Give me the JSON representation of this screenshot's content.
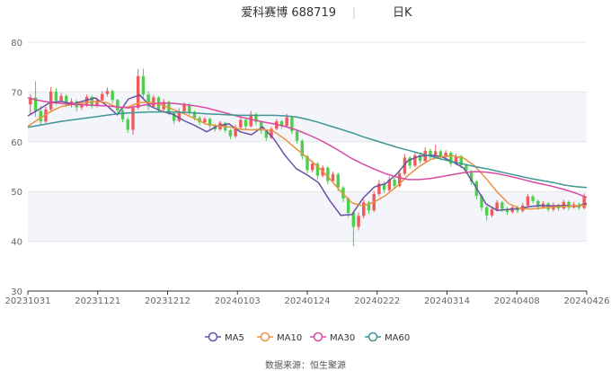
{
  "chart_data": {
    "type": "candlestick",
    "title": "爱科赛博 688719",
    "period_label": "日K",
    "ylim": [
      30,
      80
    ],
    "y_ticks": [
      "80",
      "70",
      "60",
      "50",
      "40",
      "30"
    ],
    "x_ticks": [
      "20231031",
      "20231121",
      "20231212",
      "20240103",
      "20240124",
      "20240222",
      "20240314",
      "20240408",
      "20240426"
    ],
    "legend": [
      {
        "name": "MA5",
        "color": "#6a4fa5"
      },
      {
        "name": "MA10",
        "color": "#e8913e"
      },
      {
        "name": "MA30",
        "color": "#d84aa2"
      },
      {
        "name": "MA60",
        "color": "#3e9695"
      }
    ],
    "up_color": "#f05a5a",
    "down_color": "#4cd04c",
    "grid": true,
    "candles": [
      {
        "o": 67.5,
        "c": 68.9,
        "h": 69.5,
        "l": 65.5
      },
      {
        "o": 68.9,
        "c": 66.2,
        "h": 72.2,
        "l": 65.0
      },
      {
        "o": 66.2,
        "c": 64.1,
        "h": 67.2,
        "l": 63.3
      },
      {
        "o": 64.1,
        "c": 66.5,
        "h": 67.0,
        "l": 63.8
      },
      {
        "o": 66.5,
        "c": 70.1,
        "h": 71.0,
        "l": 66.0
      },
      {
        "o": 70.1,
        "c": 68.3,
        "h": 70.8,
        "l": 67.4
      },
      {
        "o": 68.3,
        "c": 69.2,
        "h": 69.8,
        "l": 67.9
      },
      {
        "o": 69.2,
        "c": 67.6,
        "h": 69.6,
        "l": 67.0
      },
      {
        "o": 67.6,
        "c": 68.1,
        "h": 68.7,
        "l": 66.9
      },
      {
        "o": 68.1,
        "c": 66.9,
        "h": 68.4,
        "l": 66.2
      },
      {
        "o": 66.9,
        "c": 67.3,
        "h": 67.9,
        "l": 66.4
      },
      {
        "o": 67.3,
        "c": 69.0,
        "h": 69.5,
        "l": 67.0
      },
      {
        "o": 69.0,
        "c": 67.2,
        "h": 69.3,
        "l": 66.6
      },
      {
        "o": 67.2,
        "c": 68.3,
        "h": 68.9,
        "l": 66.9
      },
      {
        "o": 68.3,
        "c": 69.6,
        "h": 70.2,
        "l": 68.0
      },
      {
        "o": 69.6,
        "c": 70.2,
        "h": 70.9,
        "l": 69.1
      },
      {
        "o": 70.2,
        "c": 68.4,
        "h": 70.5,
        "l": 67.7
      },
      {
        "o": 68.4,
        "c": 66.3,
        "h": 68.6,
        "l": 65.8
      },
      {
        "o": 66.3,
        "c": 64.5,
        "h": 66.7,
        "l": 63.9
      },
      {
        "o": 64.5,
        "c": 62.4,
        "h": 65.0,
        "l": 61.8
      },
      {
        "o": 62.4,
        "c": 66.8,
        "h": 67.5,
        "l": 61.4
      },
      {
        "o": 66.8,
        "c": 73.2,
        "h": 74.6,
        "l": 66.5
      },
      {
        "o": 73.2,
        "c": 69.5,
        "h": 74.7,
        "l": 68.5
      },
      {
        "o": 69.5,
        "c": 67.1,
        "h": 70.2,
        "l": 66.3
      },
      {
        "o": 67.1,
        "c": 68.9,
        "h": 69.4,
        "l": 66.8
      },
      {
        "o": 68.9,
        "c": 66.5,
        "h": 69.2,
        "l": 66.0
      },
      {
        "o": 66.5,
        "c": 68.0,
        "h": 68.6,
        "l": 66.1
      },
      {
        "o": 68.0,
        "c": 65.8,
        "h": 68.3,
        "l": 65.3
      },
      {
        "o": 65.8,
        "c": 64.2,
        "h": 66.1,
        "l": 63.6
      },
      {
        "o": 64.2,
        "c": 66.1,
        "h": 66.7,
        "l": 63.9
      },
      {
        "o": 66.1,
        "c": 67.4,
        "h": 67.9,
        "l": 65.8
      },
      {
        "o": 67.4,
        "c": 66.0,
        "h": 67.8,
        "l": 65.4
      },
      {
        "o": 66.0,
        "c": 64.8,
        "h": 66.3,
        "l": 64.3
      },
      {
        "o": 64.8,
        "c": 63.9,
        "h": 65.2,
        "l": 63.4
      },
      {
        "o": 63.9,
        "c": 64.6,
        "h": 65.0,
        "l": 63.6
      },
      {
        "o": 64.6,
        "c": 63.2,
        "h": 64.9,
        "l": 62.7
      },
      {
        "o": 63.2,
        "c": 62.5,
        "h": 63.6,
        "l": 62.0
      },
      {
        "o": 62.5,
        "c": 63.8,
        "h": 64.2,
        "l": 62.2
      },
      {
        "o": 63.8,
        "c": 62.3,
        "h": 64.0,
        "l": 61.9
      },
      {
        "o": 62.3,
        "c": 61.1,
        "h": 62.6,
        "l": 60.5
      },
      {
        "o": 61.1,
        "c": 62.9,
        "h": 63.4,
        "l": 60.8
      },
      {
        "o": 62.9,
        "c": 64.4,
        "h": 64.9,
        "l": 62.6
      },
      {
        "o": 64.4,
        "c": 63.1,
        "h": 64.7,
        "l": 62.6
      },
      {
        "o": 63.1,
        "c": 65.5,
        "h": 66.2,
        "l": 62.9
      },
      {
        "o": 65.5,
        "c": 64.0,
        "h": 65.9,
        "l": 63.4
      },
      {
        "o": 64.0,
        "c": 62.2,
        "h": 64.3,
        "l": 61.6
      },
      {
        "o": 62.2,
        "c": 60.8,
        "h": 62.5,
        "l": 60.2
      },
      {
        "o": 60.8,
        "c": 62.6,
        "h": 63.0,
        "l": 60.5
      },
      {
        "o": 62.6,
        "c": 64.1,
        "h": 64.6,
        "l": 62.3
      },
      {
        "o": 64.1,
        "c": 63.2,
        "h": 64.4,
        "l": 62.7
      },
      {
        "o": 63.2,
        "c": 64.9,
        "h": 65.6,
        "l": 62.9
      },
      {
        "o": 64.9,
        "c": 62.1,
        "h": 65.2,
        "l": 61.5
      },
      {
        "o": 62.1,
        "c": 60.2,
        "h": 62.4,
        "l": 59.6
      },
      {
        "o": 60.2,
        "c": 57.1,
        "h": 60.5,
        "l": 56.4
      },
      {
        "o": 57.1,
        "c": 54.3,
        "h": 57.4,
        "l": 53.6
      },
      {
        "o": 54.3,
        "c": 55.6,
        "h": 56.2,
        "l": 53.8
      },
      {
        "o": 55.6,
        "c": 53.2,
        "h": 55.9,
        "l": 52.5
      },
      {
        "o": 53.2,
        "c": 54.8,
        "h": 55.3,
        "l": 52.8
      },
      {
        "o": 54.8,
        "c": 52.1,
        "h": 55.1,
        "l": 51.4
      },
      {
        "o": 52.1,
        "c": 53.5,
        "h": 54.0,
        "l": 51.7
      },
      {
        "o": 53.5,
        "c": 50.8,
        "h": 53.8,
        "l": 50.1
      },
      {
        "o": 50.8,
        "c": 48.6,
        "h": 51.1,
        "l": 47.9
      },
      {
        "o": 48.6,
        "c": 45.7,
        "h": 48.9,
        "l": 44.8
      },
      {
        "o": 45.7,
        "c": 42.9,
        "h": 46.0,
        "l": 39.0
      },
      {
        "o": 42.9,
        "c": 45.1,
        "h": 45.8,
        "l": 42.2
      },
      {
        "o": 45.1,
        "c": 47.8,
        "h": 48.4,
        "l": 44.6
      },
      {
        "o": 47.8,
        "c": 46.2,
        "h": 48.1,
        "l": 45.5
      },
      {
        "o": 46.2,
        "c": 49.5,
        "h": 50.1,
        "l": 45.9
      },
      {
        "o": 49.5,
        "c": 51.6,
        "h": 52.3,
        "l": 49.1
      },
      {
        "o": 51.6,
        "c": 50.3,
        "h": 52.0,
        "l": 49.7
      },
      {
        "o": 50.3,
        "c": 52.4,
        "h": 53.0,
        "l": 50.0
      },
      {
        "o": 52.4,
        "c": 51.1,
        "h": 52.8,
        "l": 50.5
      },
      {
        "o": 51.1,
        "c": 53.6,
        "h": 54.2,
        "l": 50.8
      },
      {
        "o": 53.6,
        "c": 56.8,
        "h": 57.5,
        "l": 53.2
      },
      {
        "o": 56.8,
        "c": 55.2,
        "h": 57.1,
        "l": 54.6
      },
      {
        "o": 55.2,
        "c": 57.3,
        "h": 58.0,
        "l": 54.9
      },
      {
        "o": 57.3,
        "c": 56.1,
        "h": 57.7,
        "l": 55.6
      },
      {
        "o": 56.1,
        "c": 58.2,
        "h": 58.9,
        "l": 55.8
      },
      {
        "o": 58.2,
        "c": 57.0,
        "h": 58.6,
        "l": 56.4
      },
      {
        "o": 57.0,
        "c": 58.1,
        "h": 59.4,
        "l": 56.7
      },
      {
        "o": 58.1,
        "c": 56.9,
        "h": 58.4,
        "l": 56.3
      },
      {
        "o": 56.9,
        "c": 57.8,
        "h": 58.3,
        "l": 56.5
      },
      {
        "o": 57.8,
        "c": 55.6,
        "h": 58.1,
        "l": 55.0
      },
      {
        "o": 55.6,
        "c": 57.1,
        "h": 57.6,
        "l": 55.3
      },
      {
        "o": 57.1,
        "c": 55.3,
        "h": 57.4,
        "l": 54.7
      },
      {
        "o": 55.3,
        "c": 54.1,
        "h": 55.6,
        "l": 53.5
      },
      {
        "o": 54.1,
        "c": 52.0,
        "h": 54.4,
        "l": 51.3
      },
      {
        "o": 52.0,
        "c": 49.1,
        "h": 52.3,
        "l": 48.4
      },
      {
        "o": 49.1,
        "c": 46.8,
        "h": 49.4,
        "l": 46.1
      },
      {
        "o": 46.8,
        "c": 45.2,
        "h": 47.1,
        "l": 44.1
      },
      {
        "o": 45.2,
        "c": 46.4,
        "h": 46.9,
        "l": 44.8
      },
      {
        "o": 46.4,
        "c": 47.8,
        "h": 48.3,
        "l": 46.0
      },
      {
        "o": 47.8,
        "c": 46.5,
        "h": 48.1,
        "l": 45.9
      },
      {
        "o": 46.5,
        "c": 45.9,
        "h": 46.9,
        "l": 45.3
      },
      {
        "o": 45.9,
        "c": 46.8,
        "h": 47.3,
        "l": 45.5
      },
      {
        "o": 46.8,
        "c": 46.1,
        "h": 47.2,
        "l": 45.6
      },
      {
        "o": 46.1,
        "c": 47.2,
        "h": 47.7,
        "l": 45.8
      },
      {
        "o": 47.2,
        "c": 49.0,
        "h": 49.5,
        "l": 46.9
      },
      {
        "o": 49.0,
        "c": 48.1,
        "h": 49.4,
        "l": 47.6
      },
      {
        "o": 48.1,
        "c": 46.9,
        "h": 48.4,
        "l": 46.3
      },
      {
        "o": 46.9,
        "c": 47.6,
        "h": 48.1,
        "l": 46.5
      },
      {
        "o": 47.6,
        "c": 46.4,
        "h": 47.9,
        "l": 45.9
      },
      {
        "o": 46.4,
        "c": 47.3,
        "h": 47.8,
        "l": 46.0
      },
      {
        "o": 47.3,
        "c": 46.6,
        "h": 47.6,
        "l": 46.1
      },
      {
        "o": 46.6,
        "c": 47.9,
        "h": 48.3,
        "l": 46.3
      },
      {
        "o": 47.9,
        "c": 46.8,
        "h": 48.2,
        "l": 46.2
      },
      {
        "o": 46.8,
        "c": 47.4,
        "h": 47.9,
        "l": 46.5
      },
      {
        "o": 47.4,
        "c": 46.7,
        "h": 47.8,
        "l": 46.3
      },
      {
        "o": 46.7,
        "c": 49.1,
        "h": 49.6,
        "l": 46.4
      }
    ],
    "series": [
      {
        "name": "MA5",
        "x_frac": [
          0,
          0.02,
          0.04,
          0.06,
          0.08,
          0.1,
          0.12,
          0.14,
          0.16,
          0.18,
          0.2,
          0.22,
          0.24,
          0.26,
          0.28,
          0.3,
          0.32,
          0.34,
          0.36,
          0.38,
          0.4,
          0.42,
          0.44,
          0.46,
          0.48,
          0.5,
          0.52,
          0.54,
          0.56,
          0.58,
          0.6,
          0.62,
          0.64,
          0.66,
          0.68,
          0.7,
          0.72,
          0.74,
          0.76,
          0.78,
          0.8,
          0.82,
          0.84,
          0.86,
          0.88,
          0.9,
          0.92,
          0.94,
          0.96,
          0.98,
          1.0
        ],
        "values": [
          65.2,
          66.5,
          67.9,
          68.1,
          67.6,
          68.2,
          68.8,
          67.4,
          65.4,
          68.6,
          69.4,
          67.1,
          66.1,
          65.5,
          64.2,
          63.2,
          62.0,
          63.2,
          63.6,
          62.0,
          61.4,
          63.0,
          60.6,
          57.3,
          54.6,
          53.3,
          51.8,
          48.2,
          45.2,
          45.4,
          48.7,
          50.9,
          51.6,
          53.5,
          56.2,
          57.1,
          57.3,
          57.0,
          56.0,
          54.7,
          51.2,
          47.5,
          46.2,
          46.4,
          46.6,
          47.0,
          47.2,
          47.1,
          47.2,
          47.0,
          47.6
        ]
      },
      {
        "name": "MA10",
        "x_frac": [
          0,
          0.02,
          0.04,
          0.06,
          0.08,
          0.1,
          0.12,
          0.14,
          0.16,
          0.18,
          0.2,
          0.22,
          0.24,
          0.26,
          0.28,
          0.3,
          0.32,
          0.34,
          0.36,
          0.38,
          0.4,
          0.42,
          0.44,
          0.46,
          0.48,
          0.5,
          0.52,
          0.54,
          0.56,
          0.58,
          0.6,
          0.62,
          0.64,
          0.66,
          0.68,
          0.7,
          0.72,
          0.74,
          0.76,
          0.78,
          0.8,
          0.82,
          0.84,
          0.86,
          0.88,
          0.9,
          0.92,
          0.94,
          0.96,
          0.98,
          1.0
        ],
        "values": [
          63.1,
          64.6,
          66.0,
          67.1,
          67.5,
          67.8,
          68.1,
          67.9,
          66.9,
          67.0,
          67.9,
          67.9,
          67.4,
          66.5,
          65.6,
          64.6,
          63.5,
          63.2,
          63.0,
          62.5,
          62.4,
          62.5,
          62.1,
          60.5,
          58.6,
          56.8,
          54.9,
          52.6,
          50.0,
          47.7,
          47.1,
          47.9,
          49.2,
          51.0,
          53.2,
          55.0,
          56.4,
          57.0,
          57.2,
          56.7,
          55.1,
          52.6,
          49.9,
          47.6,
          46.6,
          46.5,
          46.7,
          46.9,
          47.0,
          47.1,
          47.3
        ]
      },
      {
        "name": "MA30",
        "x_frac": [
          0,
          0.02,
          0.04,
          0.06,
          0.08,
          0.1,
          0.12,
          0.14,
          0.16,
          0.18,
          0.2,
          0.22,
          0.24,
          0.26,
          0.28,
          0.3,
          0.32,
          0.34,
          0.36,
          0.38,
          0.4,
          0.42,
          0.44,
          0.46,
          0.48,
          0.5,
          0.52,
          0.54,
          0.56,
          0.58,
          0.6,
          0.62,
          0.64,
          0.66,
          0.68,
          0.7,
          0.72,
          0.74,
          0.76,
          0.78,
          0.8,
          0.82,
          0.84,
          0.86,
          0.88,
          0.9,
          0.92,
          0.94,
          0.96,
          0.98,
          1.0
        ],
        "values": [
          68.8,
          68.3,
          67.9,
          67.7,
          67.5,
          67.4,
          67.3,
          67.2,
          67.0,
          66.8,
          67.2,
          67.6,
          67.8,
          67.7,
          67.5,
          67.2,
          66.8,
          66.2,
          65.6,
          65.0,
          64.5,
          64.0,
          63.6,
          63.1,
          62.4,
          61.5,
          60.5,
          59.3,
          58.0,
          56.6,
          55.5,
          54.5,
          53.6,
          52.9,
          52.4,
          52.4,
          52.6,
          53.0,
          53.4,
          53.8,
          54.0,
          53.9,
          53.6,
          53.1,
          52.6,
          52.0,
          51.5,
          51.0,
          50.4,
          49.7,
          48.8
        ]
      },
      {
        "name": "MA60",
        "x_frac": [
          0,
          0.02,
          0.04,
          0.06,
          0.08,
          0.1,
          0.12,
          0.14,
          0.16,
          0.18,
          0.2,
          0.22,
          0.24,
          0.26,
          0.28,
          0.3,
          0.32,
          0.34,
          0.36,
          0.38,
          0.4,
          0.42,
          0.44,
          0.46,
          0.48,
          0.5,
          0.52,
          0.54,
          0.56,
          0.58,
          0.6,
          0.62,
          0.64,
          0.66,
          0.68,
          0.7,
          0.72,
          0.74,
          0.76,
          0.78,
          0.8,
          0.82,
          0.84,
          0.86,
          0.88,
          0.9,
          0.92,
          0.94,
          0.96,
          0.98,
          1.0
        ],
        "values": [
          62.9,
          63.3,
          63.7,
          64.1,
          64.4,
          64.7,
          65.0,
          65.3,
          65.6,
          65.8,
          65.9,
          66.0,
          66.0,
          66.0,
          65.9,
          65.8,
          65.6,
          65.5,
          65.4,
          65.3,
          65.3,
          65.3,
          65.3,
          65.2,
          65.0,
          64.5,
          63.9,
          63.2,
          62.5,
          61.8,
          61.0,
          60.3,
          59.6,
          58.9,
          58.3,
          57.7,
          57.1,
          56.5,
          56.0,
          55.5,
          55.0,
          54.6,
          54.1,
          53.6,
          53.1,
          52.6,
          52.2,
          51.8,
          51.3,
          51.0,
          50.8
        ]
      }
    ],
    "source_text": "数据来源：恒生聚源"
  }
}
